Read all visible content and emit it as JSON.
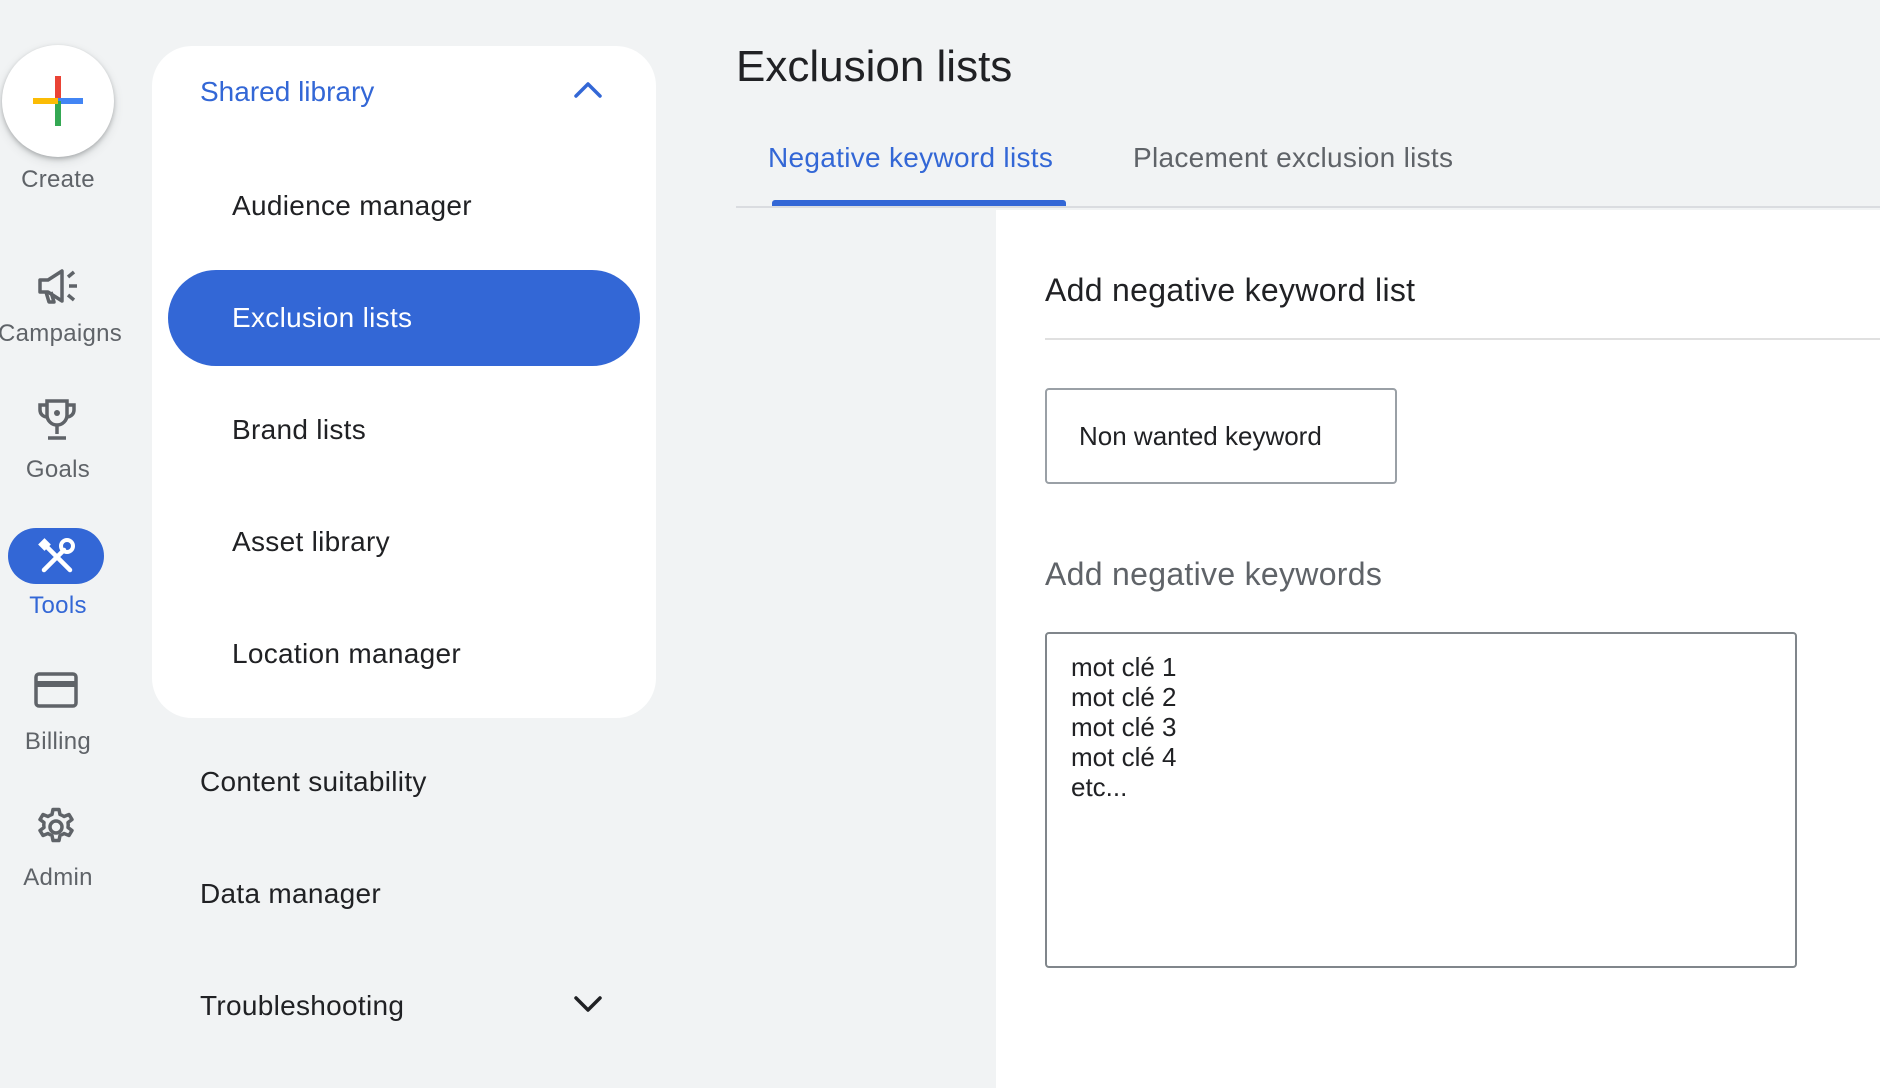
{
  "rail": {
    "create_label": "Create",
    "items": [
      {
        "label": "Campaigns",
        "icon": "megaphone-icon"
      },
      {
        "label": "Goals",
        "icon": "trophy-icon"
      },
      {
        "label": "Tools",
        "icon": "tools-icon",
        "active": true
      },
      {
        "label": "Billing",
        "icon": "credit-card-icon"
      },
      {
        "label": "Admin",
        "icon": "gear-icon"
      }
    ]
  },
  "nav": {
    "header": "Shared library",
    "sub_items": [
      {
        "label": "Audience manager"
      },
      {
        "label": "Exclusion lists",
        "selected": true
      },
      {
        "label": "Brand lists"
      },
      {
        "label": "Asset library"
      },
      {
        "label": "Location manager"
      }
    ],
    "top_items": [
      {
        "label": "Content suitability"
      },
      {
        "label": "Data manager"
      },
      {
        "label": "Troubleshooting"
      }
    ]
  },
  "main": {
    "title": "Exclusion lists",
    "tabs": [
      {
        "label": "Negative keyword lists",
        "active": true
      },
      {
        "label": "Placement exclusion lists",
        "active": false
      }
    ],
    "card": {
      "title": "Add negative keyword list",
      "name_value": "Non wanted keyword",
      "keywords_label": "Add negative keywords",
      "keywords_value": "mot clé 1\nmot clé 2\nmot clé 3\nmot clé 4\netc..."
    }
  },
  "colors": {
    "accent": "#3367d6",
    "background": "#f1f3f4",
    "text_primary": "#202124",
    "text_secondary": "#5f6368"
  }
}
